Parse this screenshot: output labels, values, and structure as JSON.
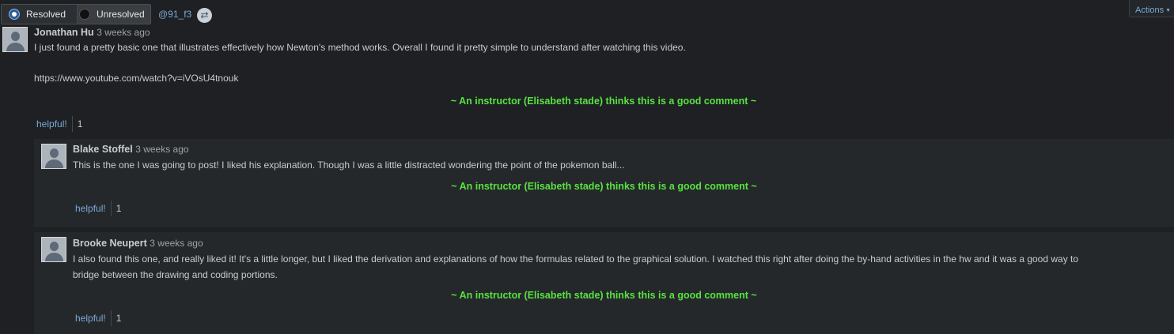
{
  "filter": {
    "resolved_label": "Resolved",
    "unresolved_label": "Unresolved",
    "selected": "Resolved"
  },
  "post_tag": "@91_f3",
  "actions_label": "Actions",
  "main_comment": {
    "author": "Jonathan Hu",
    "time": "3 weeks ago",
    "text_line1": "I just found a pretty basic one that illustrates effectively how Newton's method works. Overall I found it pretty simple to understand after watching this video.",
    "link": "https://www.youtube.com/watch?v=iVOsU4tnouk",
    "endorsement": "~ An instructor (Elisabeth stade) thinks this is a good comment ~",
    "helpful_label": "helpful!",
    "helpful_count": "1"
  },
  "replies": [
    {
      "author": "Blake Stoffel",
      "time": "3 weeks ago",
      "text": "This is the one I was going to post! I liked his explanation. Though I was a little distracted wondering the point of the pokemon ball...",
      "endorsement": "~ An instructor (Elisabeth stade) thinks this is a good comment ~",
      "helpful_label": "helpful!",
      "helpful_count": "1"
    },
    {
      "author": "Brooke Neupert",
      "time": "3 weeks ago",
      "text_line1": "I also found this one, and really liked it! It's a little longer, but I liked the derivation and explanations of how the formulas related to the graphical solution. I watched this right after doing the by-hand activities in the hw and it was a good way to",
      "text_line2": "bridge between the drawing and coding portions.",
      "endorsement": "~ An instructor (Elisabeth stade) thinks this is a good comment ~",
      "helpful_label": "helpful!",
      "helpful_count": "1"
    }
  ],
  "colors": {
    "background": "#1e2023",
    "endorsement": "#58e33f",
    "link": "#7aa8d6"
  },
  "icons": [
    "radio-checked-icon",
    "radio-unchecked-icon",
    "link-icon",
    "caret-down-icon",
    "avatar-icon"
  ]
}
